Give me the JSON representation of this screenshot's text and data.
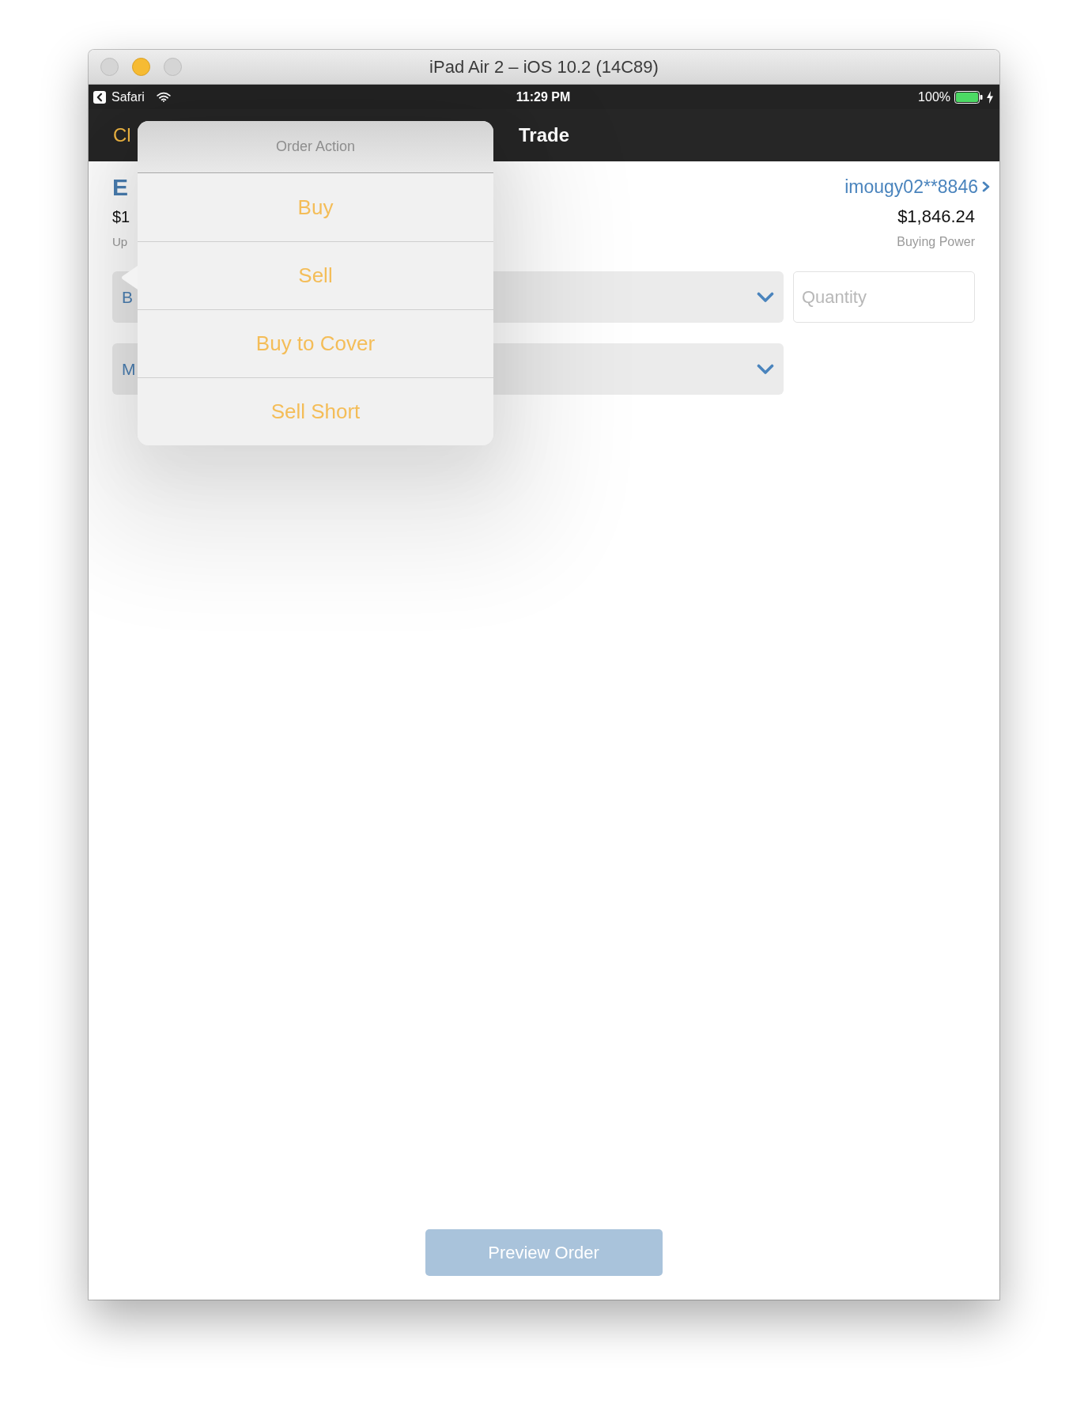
{
  "window": {
    "title": "iPad Air 2 – iOS 10.2 (14C89)",
    "controls": [
      {
        "kind": "close",
        "enabled": false
      },
      {
        "kind": "minimize",
        "enabled": true
      },
      {
        "kind": "zoom",
        "enabled": false
      }
    ]
  },
  "status_bar": {
    "back_label": "Safari",
    "time": "11:29 PM",
    "battery": "100%"
  },
  "nav_bar": {
    "left_button": "Cl",
    "title": "Trade"
  },
  "quote": {
    "symbol": "E",
    "price": "$1",
    "caption": "Up"
  },
  "account": {
    "name": "imougy02**8846",
    "buying_power": "$1,846.24",
    "caption": "Buying Power"
  },
  "order_form": {
    "order_action": "B",
    "quantity": {
      "placeholder": "Quantity"
    },
    "order_type": "M"
  },
  "popover": {
    "title": "Order Action",
    "items": [
      "Buy",
      "Sell",
      "Buy to Cover",
      "Sell Short"
    ]
  },
  "preview_button": {
    "label": "Preview Order",
    "disabled": true
  }
}
